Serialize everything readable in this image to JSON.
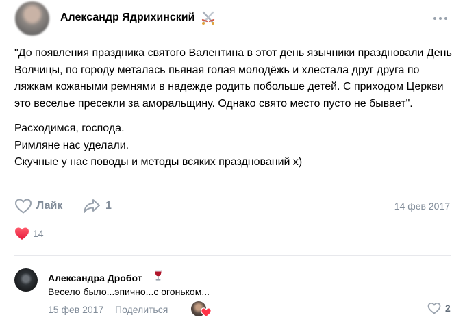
{
  "post": {
    "author_name": "Александр Ядрихинский",
    "paragraphs": [
      "\"До появления праздника святого Валентина в этот день язычники праздновали День Волчицы, по городу металась пьяная голая молодёжь и хлестала друг друга по ляжкам кожаными ремнями в надежде родить побольше детей. С приходом Церкви это веселье пресекли за аморальщину. Однако свято место пусто не бывает\".",
      "Расходимся, господа.\nРимляне нас уделали.\nСкучные у нас поводы и методы всяких празднований х)"
    ],
    "like_label": "Лайк",
    "share_count": "1",
    "date": "14 фев 2017",
    "reactions_count": "14"
  },
  "comment": {
    "author_name": "Александра Дробот",
    "text": "Весело было...эпично...с огоньком...",
    "date": "15 фев 2017",
    "share_label": "Поделиться",
    "like_count": "2"
  },
  "colors": {
    "secondary_text": "#818c99",
    "icon": "#99a2ad",
    "heart": "#ff3347"
  },
  "icons": [
    "more-icon",
    "heart-outline-icon",
    "share-arrow-icon",
    "heart-reaction-icon",
    "wine-glass-icon",
    "crossed-swords-badge-icon"
  ]
}
